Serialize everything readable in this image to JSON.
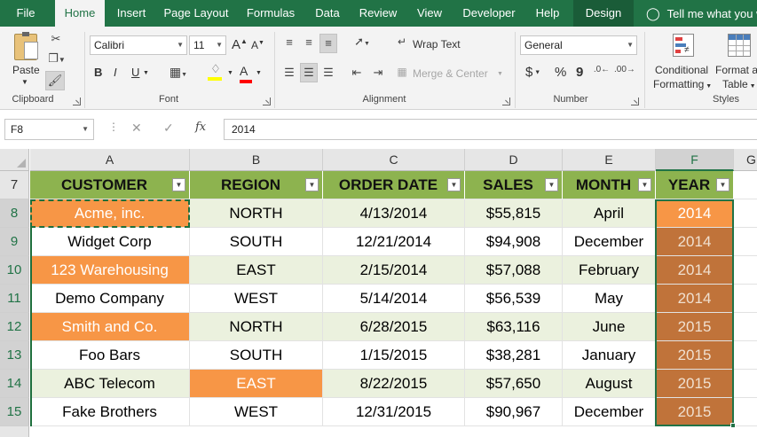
{
  "tabs": [
    {
      "name": "tab-file",
      "label": "File"
    },
    {
      "name": "tab-home",
      "label": "Home"
    },
    {
      "name": "tab-insert",
      "label": "Insert"
    },
    {
      "name": "tab-page-layout",
      "label": "Page Layout"
    },
    {
      "name": "tab-formulas",
      "label": "Formulas"
    },
    {
      "name": "tab-data",
      "label": "Data"
    },
    {
      "name": "tab-review",
      "label": "Review"
    },
    {
      "name": "tab-view",
      "label": "View"
    },
    {
      "name": "tab-developer",
      "label": "Developer"
    },
    {
      "name": "tab-help",
      "label": "Help"
    },
    {
      "name": "tab-design",
      "label": "Design"
    }
  ],
  "tell_me": "Tell me what you w",
  "ribbon": {
    "clipboard": {
      "paste": "Paste",
      "label": "Clipboard"
    },
    "font": {
      "name": "Calibri",
      "size": "11",
      "grow": "A",
      "shrink": "A",
      "bold": "B",
      "italic": "I",
      "underline": "U",
      "font_color": "A",
      "label": "Font"
    },
    "alignment": {
      "wrap_text": "Wrap Text",
      "merge_center": "Merge & Center",
      "label": "Alignment"
    },
    "number": {
      "format": "General",
      "currency": "$",
      "percent": "%",
      "comma": "9",
      "label": "Number"
    },
    "styles": {
      "conditional_1": "Conditional",
      "conditional_2": "Formatting",
      "format_table_1": "Format a",
      "format_table_2": "Table",
      "label": "Styles"
    }
  },
  "formula_bar": {
    "name_box": "F8",
    "fx": "fx",
    "value": "2014"
  },
  "columns": [
    "A",
    "B",
    "C",
    "D",
    "E",
    "F",
    "G"
  ],
  "rows": [
    "7",
    "8",
    "9",
    "10",
    "11",
    "12",
    "13",
    "14",
    "15"
  ],
  "table": {
    "headers": [
      "CUSTOMER",
      "REGION",
      "ORDER DATE",
      "SALES",
      "MONTH",
      "YEAR"
    ],
    "rows": [
      [
        "Acme, inc.",
        "NORTH",
        "4/13/2014",
        "$55,815",
        "April",
        "2014"
      ],
      [
        "Widget Corp",
        "SOUTH",
        "12/21/2014",
        "$94,908",
        "December",
        "2014"
      ],
      [
        "123 Warehousing",
        "EAST",
        "2/15/2014",
        "$57,088",
        "February",
        "2014"
      ],
      [
        "Demo Company",
        "WEST",
        "5/14/2014",
        "$56,539",
        "May",
        "2014"
      ],
      [
        "Smith and Co.",
        "NORTH",
        "6/28/2015",
        "$63,116",
        "June",
        "2015"
      ],
      [
        "Foo Bars",
        "SOUTH",
        "1/15/2015",
        "$38,281",
        "January",
        "2015"
      ],
      [
        "ABC Telecom",
        "EAST",
        "8/22/2015",
        "$57,650",
        "August",
        "2015"
      ],
      [
        "Fake Brothers",
        "WEST",
        "12/31/2015",
        "$90,967",
        "December",
        "2015"
      ]
    ],
    "highlight_cells": [
      [
        0,
        0
      ],
      [
        2,
        0
      ],
      [
        4,
        0
      ],
      [
        6,
        1
      ]
    ]
  },
  "colors": {
    "accent": "#217346",
    "header_fill": "#8db34f",
    "band_fill": "#ebf1de",
    "highlight": "#f79646",
    "year_fill": "#c0733a"
  }
}
